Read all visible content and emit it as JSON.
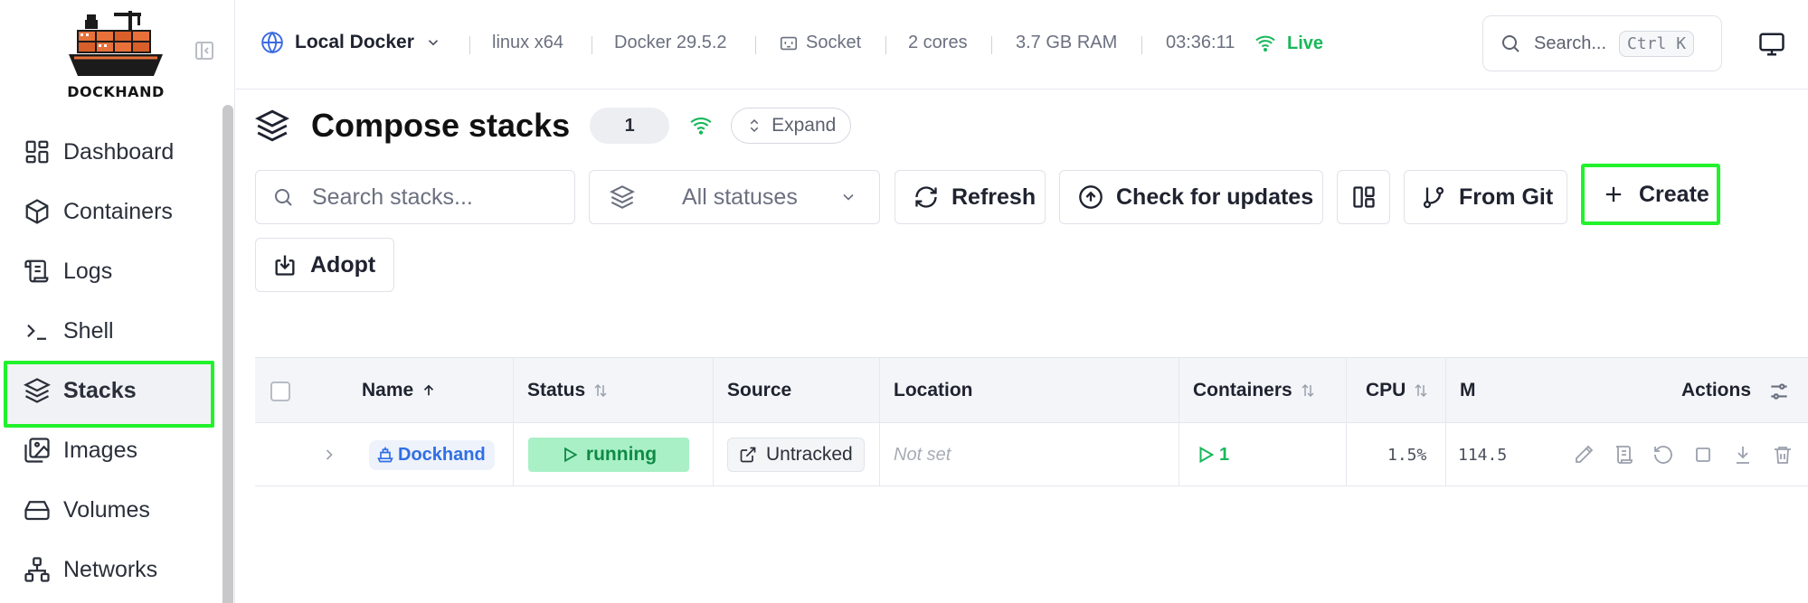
{
  "sidebar": {
    "logo_text": "DOCKHAND",
    "items": [
      {
        "label": "Dashboard",
        "icon": "dashboard-icon"
      },
      {
        "label": "Containers",
        "icon": "box-icon"
      },
      {
        "label": "Logs",
        "icon": "scroll-icon"
      },
      {
        "label": "Shell",
        "icon": "terminal-icon"
      },
      {
        "label": "Stacks",
        "icon": "layers-icon",
        "active": true
      },
      {
        "label": "Images",
        "icon": "image-icon"
      },
      {
        "label": "Volumes",
        "icon": "drive-icon"
      },
      {
        "label": "Networks",
        "icon": "network-icon"
      }
    ]
  },
  "topbar": {
    "environment": "Local Docker",
    "platform": "linux x64",
    "docker_version": "Docker 29.5.2",
    "connection": "Socket",
    "cores": "2 cores",
    "ram": "3.7 GB RAM",
    "time": "03:36:11",
    "live_label": "Live",
    "search_placeholder": "Search...",
    "shortcut": "Ctrl K"
  },
  "page": {
    "title": "Compose stacks",
    "count": "1",
    "expand_label": "Expand"
  },
  "toolbar": {
    "search_placeholder": "Search stacks...",
    "status_filter": "All statuses",
    "refresh_label": "Refresh",
    "check_updates_label": "Check for updates",
    "from_git_label": "From Git",
    "create_label": "Create",
    "adopt_label": "Adopt"
  },
  "table": {
    "columns": {
      "name": "Name",
      "status": "Status",
      "source": "Source",
      "location": "Location",
      "containers": "Containers",
      "cpu": "CPU",
      "memory": "M",
      "actions": "Actions"
    },
    "rows": [
      {
        "name": "Dockhand",
        "status": "running",
        "source": "Untracked",
        "location": "Not set",
        "containers": "1",
        "cpu": "1.5%",
        "memory": "114.5"
      }
    ]
  },
  "colors": {
    "accent_blue": "#2f6fe4",
    "live_green": "#18b85a",
    "running_bg": "#a9f0c7",
    "highlight": "#21f22c"
  }
}
